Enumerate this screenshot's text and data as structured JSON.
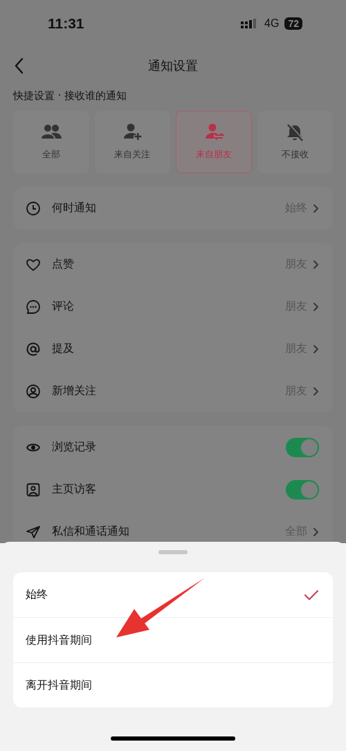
{
  "status_bar": {
    "time": "11:31",
    "network": "4G",
    "battery": "72"
  },
  "nav": {
    "title": "通知设置"
  },
  "quick_settings": {
    "label": "快捷设置 · 接收谁的通知",
    "options": [
      {
        "label": "全部",
        "selected": false
      },
      {
        "label": "来自关注",
        "selected": false
      },
      {
        "label": "来自朋友",
        "selected": true
      },
      {
        "label": "不接收",
        "selected": false
      }
    ]
  },
  "groups": [
    {
      "rows": [
        {
          "kind": "link",
          "label": "何时通知",
          "value": "始终"
        }
      ]
    },
    {
      "rows": [
        {
          "kind": "link",
          "label": "点赞",
          "value": "朋友"
        },
        {
          "kind": "link",
          "label": "评论",
          "value": "朋友"
        },
        {
          "kind": "link",
          "label": "提及",
          "value": "朋友"
        },
        {
          "kind": "link",
          "label": "新增关注",
          "value": "朋友"
        }
      ]
    },
    {
      "rows": [
        {
          "kind": "toggle",
          "label": "浏览记录",
          "on": true
        },
        {
          "kind": "toggle",
          "label": "主页访客",
          "on": true
        },
        {
          "kind": "link",
          "label": "私信和通话通知",
          "value": "全部"
        }
      ]
    }
  ],
  "sheet": {
    "options": [
      {
        "label": "始终",
        "selected": true
      },
      {
        "label": "使用抖音期间",
        "selected": false
      },
      {
        "label": "离开抖音期间",
        "selected": false
      }
    ]
  }
}
